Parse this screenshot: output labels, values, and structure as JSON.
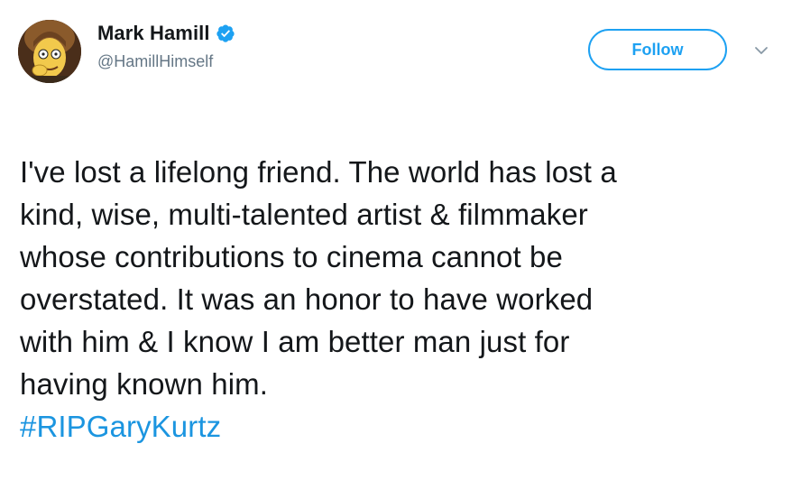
{
  "author": {
    "display_name": "Mark Hamill",
    "handle": "@HamillHimself",
    "verified": true,
    "avatar_icon": "cartoon-portrait-avatar"
  },
  "actions": {
    "follow_label": "Follow",
    "menu_icon": "chevron-down-icon"
  },
  "tweet": {
    "text": "I've lost a lifelong friend. The world has lost a\nkind, wise, multi-talented artist & filmmaker\nwhose contributions to cinema cannot be\noverstated. It was an honor to have worked\nwith him & I know I am better man just for\nhaving known him.",
    "hashtag": "#RIPGaryKurtz"
  },
  "colors": {
    "accent": "#1da1f2",
    "link": "#1b95e0",
    "text": "#14171a",
    "muted": "#657786"
  }
}
